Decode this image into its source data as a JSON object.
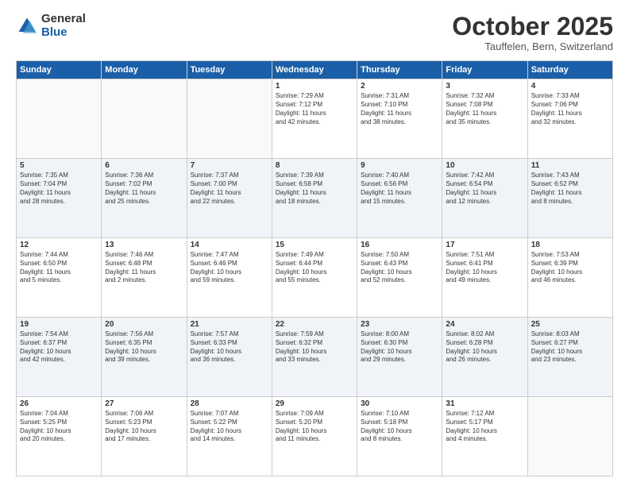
{
  "header": {
    "logo_general": "General",
    "logo_blue": "Blue",
    "month_title": "October 2025",
    "location": "Tauffelen, Bern, Switzerland"
  },
  "weekdays": [
    "Sunday",
    "Monday",
    "Tuesday",
    "Wednesday",
    "Thursday",
    "Friday",
    "Saturday"
  ],
  "weeks": [
    [
      {
        "day": "",
        "info": ""
      },
      {
        "day": "",
        "info": ""
      },
      {
        "day": "",
        "info": ""
      },
      {
        "day": "1",
        "info": "Sunrise: 7:29 AM\nSunset: 7:12 PM\nDaylight: 11 hours\nand 42 minutes."
      },
      {
        "day": "2",
        "info": "Sunrise: 7:31 AM\nSunset: 7:10 PM\nDaylight: 11 hours\nand 38 minutes."
      },
      {
        "day": "3",
        "info": "Sunrise: 7:32 AM\nSunset: 7:08 PM\nDaylight: 11 hours\nand 35 minutes."
      },
      {
        "day": "4",
        "info": "Sunrise: 7:33 AM\nSunset: 7:06 PM\nDaylight: 11 hours\nand 32 minutes."
      }
    ],
    [
      {
        "day": "5",
        "info": "Sunrise: 7:35 AM\nSunset: 7:04 PM\nDaylight: 11 hours\nand 28 minutes."
      },
      {
        "day": "6",
        "info": "Sunrise: 7:36 AM\nSunset: 7:02 PM\nDaylight: 11 hours\nand 25 minutes."
      },
      {
        "day": "7",
        "info": "Sunrise: 7:37 AM\nSunset: 7:00 PM\nDaylight: 11 hours\nand 22 minutes."
      },
      {
        "day": "8",
        "info": "Sunrise: 7:39 AM\nSunset: 6:58 PM\nDaylight: 11 hours\nand 18 minutes."
      },
      {
        "day": "9",
        "info": "Sunrise: 7:40 AM\nSunset: 6:56 PM\nDaylight: 11 hours\nand 15 minutes."
      },
      {
        "day": "10",
        "info": "Sunrise: 7:42 AM\nSunset: 6:54 PM\nDaylight: 11 hours\nand 12 minutes."
      },
      {
        "day": "11",
        "info": "Sunrise: 7:43 AM\nSunset: 6:52 PM\nDaylight: 11 hours\nand 8 minutes."
      }
    ],
    [
      {
        "day": "12",
        "info": "Sunrise: 7:44 AM\nSunset: 6:50 PM\nDaylight: 11 hours\nand 5 minutes."
      },
      {
        "day": "13",
        "info": "Sunrise: 7:46 AM\nSunset: 6:48 PM\nDaylight: 11 hours\nand 2 minutes."
      },
      {
        "day": "14",
        "info": "Sunrise: 7:47 AM\nSunset: 6:46 PM\nDaylight: 10 hours\nand 59 minutes."
      },
      {
        "day": "15",
        "info": "Sunrise: 7:49 AM\nSunset: 6:44 PM\nDaylight: 10 hours\nand 55 minutes."
      },
      {
        "day": "16",
        "info": "Sunrise: 7:50 AM\nSunset: 6:43 PM\nDaylight: 10 hours\nand 52 minutes."
      },
      {
        "day": "17",
        "info": "Sunrise: 7:51 AM\nSunset: 6:41 PM\nDaylight: 10 hours\nand 49 minutes."
      },
      {
        "day": "18",
        "info": "Sunrise: 7:53 AM\nSunset: 6:39 PM\nDaylight: 10 hours\nand 46 minutes."
      }
    ],
    [
      {
        "day": "19",
        "info": "Sunrise: 7:54 AM\nSunset: 6:37 PM\nDaylight: 10 hours\nand 42 minutes."
      },
      {
        "day": "20",
        "info": "Sunrise: 7:56 AM\nSunset: 6:35 PM\nDaylight: 10 hours\nand 39 minutes."
      },
      {
        "day": "21",
        "info": "Sunrise: 7:57 AM\nSunset: 6:33 PM\nDaylight: 10 hours\nand 36 minutes."
      },
      {
        "day": "22",
        "info": "Sunrise: 7:59 AM\nSunset: 6:32 PM\nDaylight: 10 hours\nand 33 minutes."
      },
      {
        "day": "23",
        "info": "Sunrise: 8:00 AM\nSunset: 6:30 PM\nDaylight: 10 hours\nand 29 minutes."
      },
      {
        "day": "24",
        "info": "Sunrise: 8:02 AM\nSunset: 6:28 PM\nDaylight: 10 hours\nand 26 minutes."
      },
      {
        "day": "25",
        "info": "Sunrise: 8:03 AM\nSunset: 6:27 PM\nDaylight: 10 hours\nand 23 minutes."
      }
    ],
    [
      {
        "day": "26",
        "info": "Sunrise: 7:04 AM\nSunset: 5:25 PM\nDaylight: 10 hours\nand 20 minutes."
      },
      {
        "day": "27",
        "info": "Sunrise: 7:06 AM\nSunset: 5:23 PM\nDaylight: 10 hours\nand 17 minutes."
      },
      {
        "day": "28",
        "info": "Sunrise: 7:07 AM\nSunset: 5:22 PM\nDaylight: 10 hours\nand 14 minutes."
      },
      {
        "day": "29",
        "info": "Sunrise: 7:09 AM\nSunset: 5:20 PM\nDaylight: 10 hours\nand 11 minutes."
      },
      {
        "day": "30",
        "info": "Sunrise: 7:10 AM\nSunset: 5:18 PM\nDaylight: 10 hours\nand 8 minutes."
      },
      {
        "day": "31",
        "info": "Sunrise: 7:12 AM\nSunset: 5:17 PM\nDaylight: 10 hours\nand 4 minutes."
      },
      {
        "day": "",
        "info": ""
      }
    ]
  ]
}
